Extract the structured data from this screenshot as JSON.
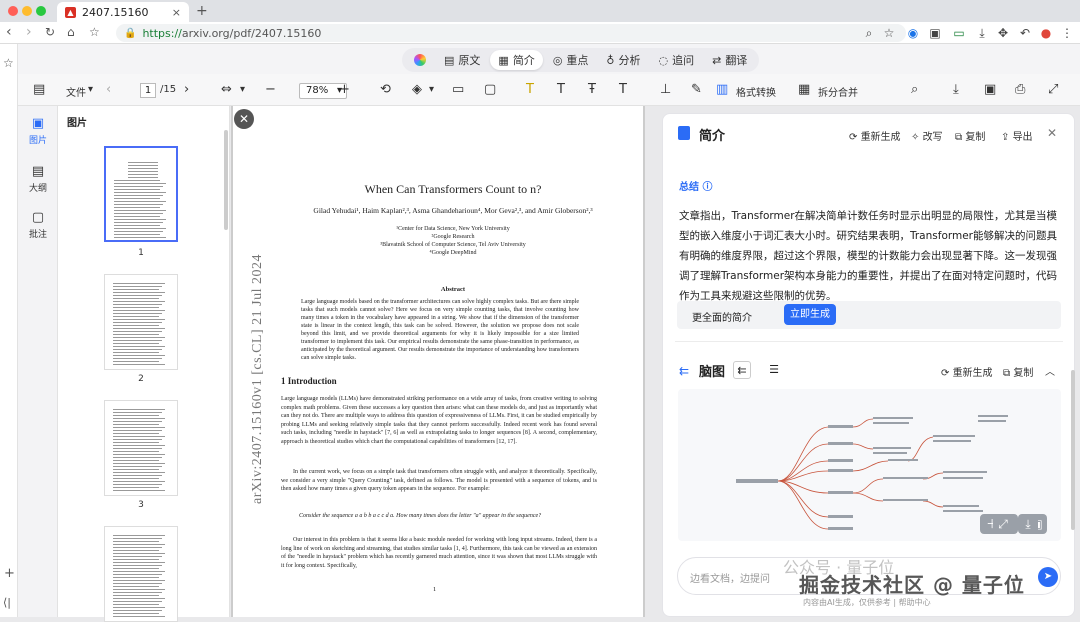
{
  "browser": {
    "tab_title": "2407.15160",
    "tab_close": "×",
    "new_tab": "+",
    "url_secure": "https://",
    "url_host": "arxiv.org",
    "url_path": "/pdf/2407.15160"
  },
  "ai_toolbar": {
    "items": [
      {
        "label": "原文",
        "icon": "doc-icon"
      },
      {
        "label": "简介",
        "icon": "summary-icon"
      },
      {
        "label": "重点",
        "icon": "target-icon"
      },
      {
        "label": "分析",
        "icon": "bulb-icon"
      },
      {
        "label": "追问",
        "icon": "chat-icon"
      },
      {
        "label": "翻译",
        "icon": "translate-icon"
      }
    ],
    "active_index": 1
  },
  "toolbar": {
    "file_label": "文件",
    "page_current": "1",
    "page_total": "/15",
    "zoom": "78%",
    "format_convert": "格式转换",
    "split_merge": "拆分合并"
  },
  "sidebar": {
    "items": [
      {
        "label": "图片",
        "icon": "image-icon"
      },
      {
        "label": "大纲",
        "icon": "outline-icon"
      },
      {
        "label": "批注",
        "icon": "comment-icon"
      }
    ],
    "thumbs_title": "图片",
    "page_numbers": [
      "1",
      "2",
      "3"
    ]
  },
  "paper": {
    "arxiv_stamp": "arXiv:2407.15160v1  [cs.CL]  21 Jul 2024",
    "title": "When Can Transformers Count to n?",
    "authors": "Gilad Yehudai¹, Haim Kaplan²,³, Asma Ghandeharioun⁴, Mor Geva²,³, and Amir Globerson²,³",
    "affiliations": [
      "¹Center for Data Science, New York University",
      "²Google Research",
      "³Blavatnik School of Computer Science, Tel Aviv University",
      "⁴Google DeepMind"
    ],
    "abstract_heading": "Abstract",
    "abstract": "Large language models based on the transformer architectures can solve highly complex tasks. But are there simple tasks that such models cannot solve? Here we focus on very simple counting tasks, that involve counting how many times a token in the vocabulary have appeared in a string. We show that if the dimension of the transformer state is linear in the context length, this task can be solved. However, the solution we propose does not scale beyond this limit, and we provide theoretical arguments for why it is likely impossible for a size limited transformer to implement this task. Our empirical results demonstrate the same phase-transition in performance, as anticipated by the theoretical argument. Our results demonstrate the importance of understanding how transformers can solve simple tasks.",
    "section_heading": "1    Introduction",
    "para1": "Large language models (LLMs) have demonstrated striking performance on a wide array of tasks, from creative writing to solving complex math problems. Given these successes a key question then arises: what can these models do, and just as importantly what can they not do. There are multiple ways to address this question of expressiveness of LLMs. First, it can be studied empirically by probing LLMs and seeking relatively simple tasks that they cannot perform successfully. Indeed recent work has found several such tasks, including \"needle in haystack\" [7, 6] as well as extrapolating tasks to longer sequences [8]. A second, complementary, approach is theoretical studies which chart the computational capabilities of transformers [12, 17].",
    "para2": "In the current work, we focus on a simple task that transformers often struggle with, and analyze it theoretically. Specifically, we consider a very simple \"Query Counting\" task, defined as follows. The model is presented with a sequence of tokens, and is then asked how many times a given query token appears in the sequence. For example:",
    "quote": "Consider the sequence a a b b a c c d a. How many times does the letter \"a\" appear in the sequence?",
    "para3": "Our interest in this problem is that it seems like a basic module needed for working with long input streams. Indeed, there is a long line of work on sketching and streaming, that studies similar tasks [1, 4]. Furthermore, this task can be viewed as an extension of the \"needle in haystack\" problem which has recently garnered much attention, since it was shown that most LLMs struggle with it for long context. Specifically,",
    "page_number": "1"
  },
  "panel": {
    "title": "简介",
    "actions": [
      "重新生成",
      "改写",
      "复制",
      "导出"
    ],
    "summary_heading": "总结",
    "summary_text": "文章指出，Transformer在解决简单计数任务时显示出明显的局限性，尤其是当模型的嵌入维度小于词汇表大小时。研究结果表明，Transformer能够解决的问题具有明确的维度界限，超过这个界限，模型的计数能力会出现显著下降。这一发现强调了理解Transformer架构本身能力的重要性，并提出了在面对特定问题时，代码作为工具来规避这些限制的优势。",
    "more_label": "更全面的简介",
    "generate_button": "立即生成",
    "mindmap_title": "脑图",
    "mindmap_actions": [
      "重新生成",
      "复制"
    ],
    "chat_placeholder": "边看文档，边提问",
    "disclaimer": "内容由AI生成，仅供参考  |  帮助中心",
    "watermark": "掘金技术社区 @ 量子位",
    "watermark2": "公众号 · 量子位"
  }
}
